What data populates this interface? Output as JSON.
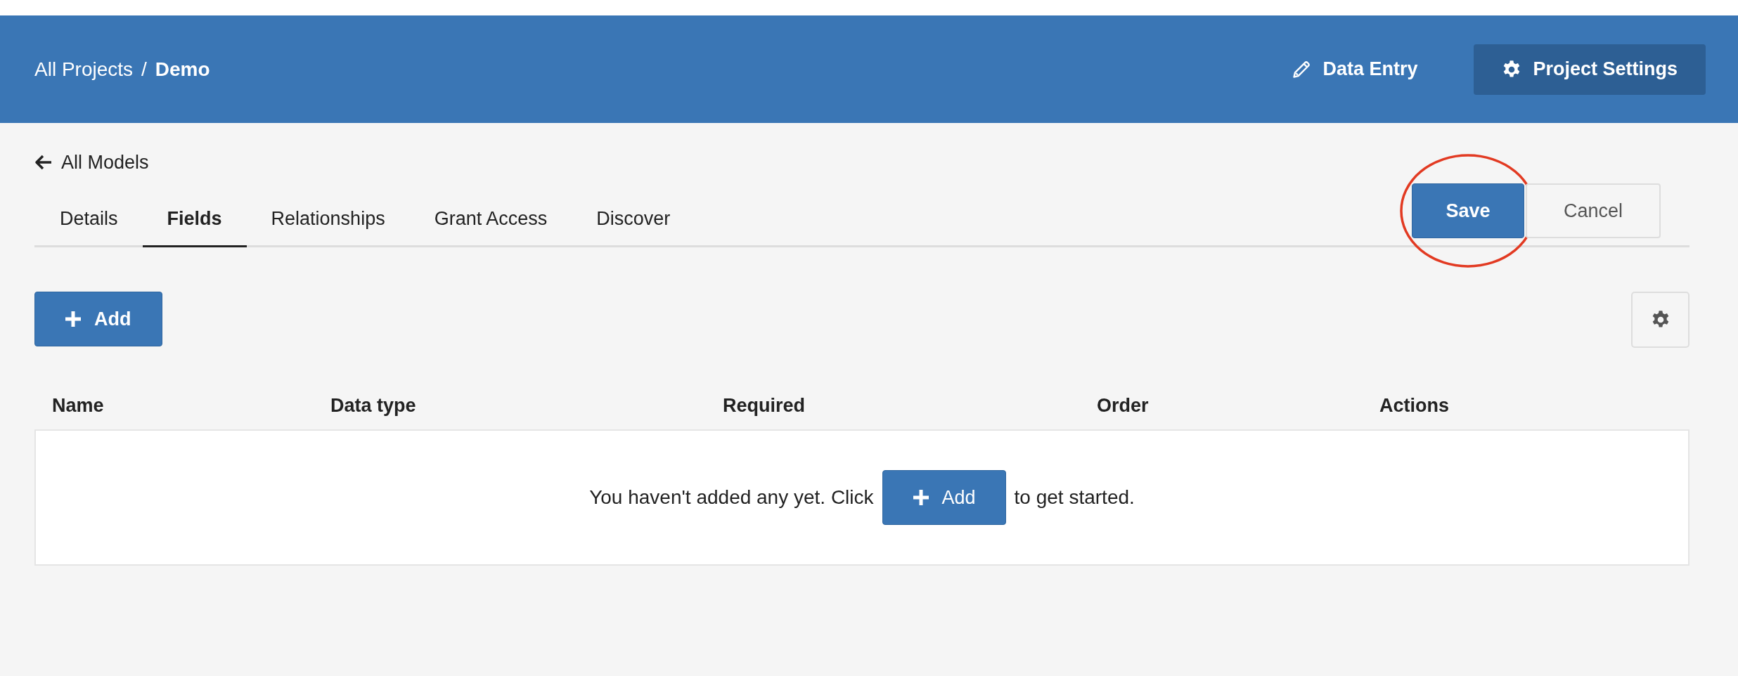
{
  "header": {
    "breadcrumb": [
      {
        "label": "All Projects",
        "current": false
      },
      {
        "label": "Demo",
        "current": true
      }
    ],
    "separator": "/",
    "nav": [
      {
        "label": "Data Entry",
        "kind": "edit",
        "selected": false
      },
      {
        "label": "Project Settings",
        "kind": "settings",
        "selected": true
      }
    ]
  },
  "back_link": {
    "label": "All Models"
  },
  "tabs": [
    {
      "label": "Details",
      "selected": false
    },
    {
      "label": "Fields",
      "selected": true
    },
    {
      "label": "Relationships",
      "selected": false
    },
    {
      "label": "Grant Access",
      "selected": false
    },
    {
      "label": "Discover",
      "selected": false
    }
  ],
  "actions": [
    {
      "label": "Save",
      "kind": "primary",
      "highlighted": true
    },
    {
      "label": "Cancel",
      "kind": "secondary",
      "highlighted": false
    }
  ],
  "toolbar": {
    "add_button": "Add"
  },
  "table": {
    "columns": [
      "Name",
      "Data type",
      "Required",
      "Order",
      "Actions"
    ],
    "empty_message": {
      "before": "You haven't added any yet. Click",
      "button": "Add",
      "after": "to get started."
    }
  }
}
